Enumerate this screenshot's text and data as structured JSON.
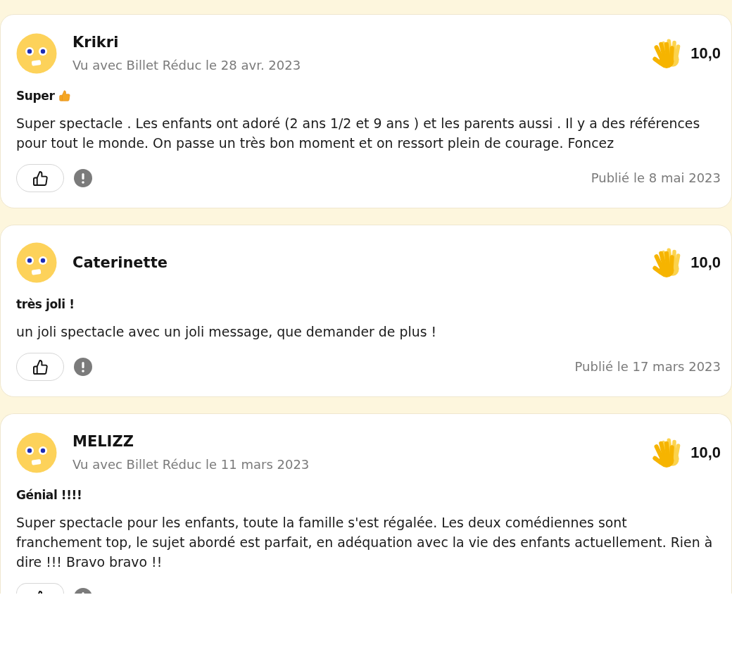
{
  "reviews": [
    {
      "author": "Krikri",
      "seen_with": "Vu avec Billet Réduc le 28 avr. 2023",
      "rating": "10,0",
      "title": "Super",
      "title_thumbs_up": true,
      "body": "Super spectacle . Les enfants ont adoré (2 ans 1/2 et 9 ans ) et les parents aussi . Il y a des références pour tout le monde. On passe un très bon moment et on ressort plein de courage. Foncez",
      "published": "Publié le 8 mai 2023",
      "clipped": false
    },
    {
      "author": "Caterinette",
      "rating": "10,0",
      "title": "très joli !",
      "title_thumbs_up": false,
      "body": "un joli spectacle avec un joli message, que demander de plus !",
      "published": "Publié le 17 mars 2023",
      "clipped": false
    },
    {
      "author": "MELIZZ",
      "seen_with": "Vu avec Billet Réduc le 11 mars 2023",
      "rating": "10,0",
      "title": "Génial !!!!",
      "title_thumbs_up": false,
      "body": "Super spectacle pour les enfants, toute la famille s'est régalée. Les deux comédiennes sont franchement top, le sujet abordé est parfait, en adéquation avec la vie des enfants actuellement. Rien à dire !!! Bravo bravo !!",
      "clipped": true
    }
  ]
}
